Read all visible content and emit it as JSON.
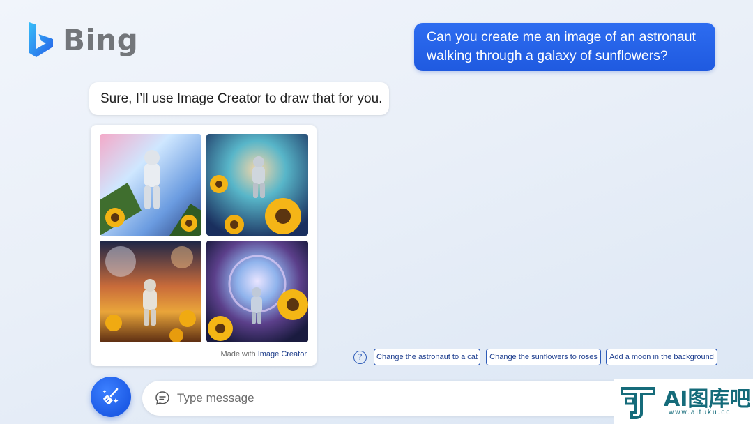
{
  "app": {
    "name": "Bing"
  },
  "chat": {
    "user_message": {
      "line1": "Can you create me an image of an astronaut",
      "line2": "walking through a galaxy of sunflowers?"
    },
    "bot_message": "Sure, I’ll use Image Creator to draw that for you.",
    "image_card": {
      "credit_prefix": "Made with ",
      "credit_link": "Image Creator"
    }
  },
  "suggestions": {
    "help_glyph": "?",
    "items": [
      "Change the astronaut to a cat",
      "Change the sunflowers to roses",
      "Add a moon in the background"
    ]
  },
  "composer": {
    "placeholder": "Type message"
  },
  "watermark": {
    "title": "AI图库吧",
    "url": "www.aituku.cc"
  },
  "colors": {
    "accent": "#1f5ae0",
    "chip_border": "#2d5bb8",
    "watermark": "#156b7a"
  },
  "icons": [
    "bing-logo-icon",
    "question-icon",
    "broom-icon",
    "chat-bubble-icon"
  ]
}
